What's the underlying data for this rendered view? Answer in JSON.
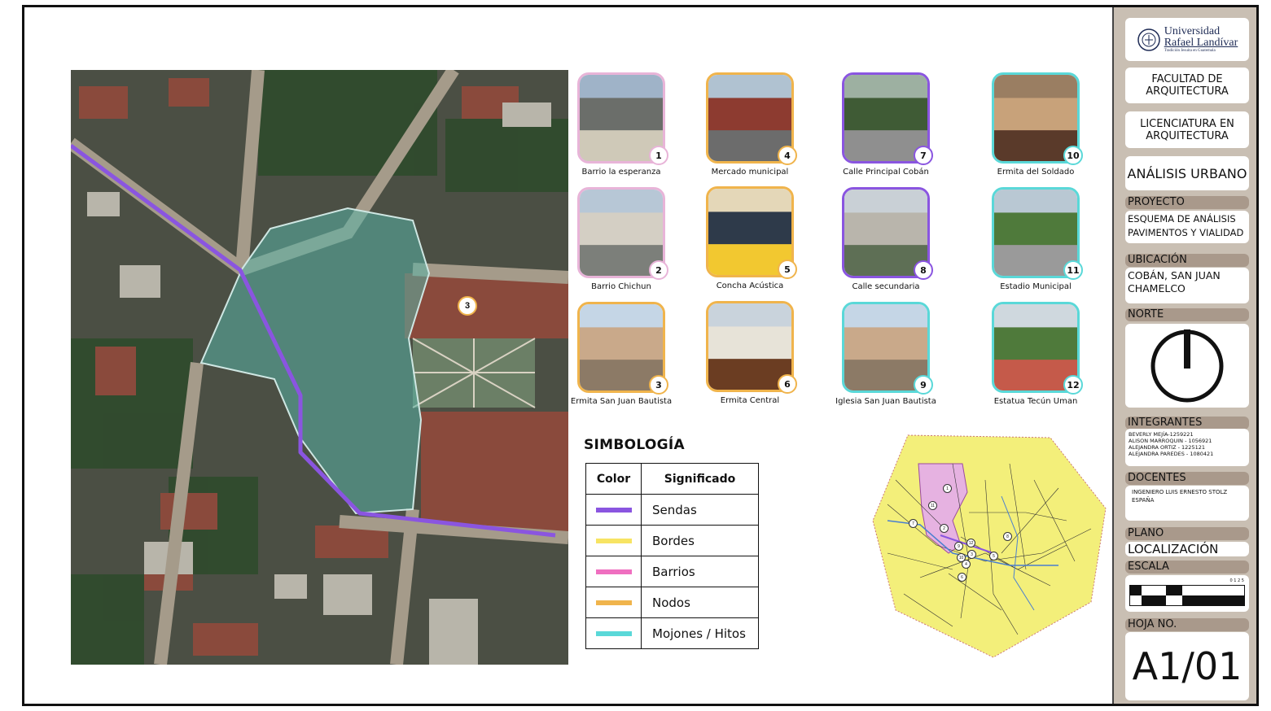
{
  "photos": [
    {
      "num": "1",
      "caption": "Barrio la esperanza",
      "color": "#e8b4d8"
    },
    {
      "num": "2",
      "caption": "Barrio Chichun",
      "color": "#e8b4d8"
    },
    {
      "num": "3",
      "caption": "Ermita San Juan Bautista",
      "color": "#f0b44c"
    },
    {
      "num": "4",
      "caption": "Mercado municipal",
      "color": "#f0b44c"
    },
    {
      "num": "5",
      "caption": "Concha Acústica",
      "color": "#f0b44c"
    },
    {
      "num": "6",
      "caption": "Ermita Central",
      "color": "#f0b44c"
    },
    {
      "num": "7",
      "caption": "Calle Principal Cobán",
      "color": "#8a55e0"
    },
    {
      "num": "8",
      "caption": "Calle secundaria",
      "color": "#8a55e0"
    },
    {
      "num": "9",
      "caption": "Iglesia San Juan Bautista",
      "color": "#5ad8d8"
    },
    {
      "num": "10",
      "caption": "Ermita del Soldado",
      "color": "#5ad8d8"
    },
    {
      "num": "11",
      "caption": "Estadio Municipal",
      "color": "#5ad8d8"
    },
    {
      "num": "12",
      "caption": "Estatua Tecún Uman",
      "color": "#5ad8d8"
    }
  ],
  "map_marker": "3",
  "legend": {
    "title": "SIMBOLOGÍA",
    "col_color": "Color",
    "col_meaning": "Significado",
    "rows": [
      {
        "label": "Sendas",
        "color": "#8a55e0"
      },
      {
        "label": "Bordes",
        "color": "#f7e463"
      },
      {
        "label": "Barrios",
        "color": "#ef6fc0"
      },
      {
        "label": "Nodos",
        "color": "#f0b44c"
      },
      {
        "label": "Mojones / Hitos",
        "color": "#5ad8d8"
      }
    ]
  },
  "locator_labels": [
    "1",
    "11",
    "7",
    "2",
    "9",
    "12",
    "3",
    "4",
    "5",
    "6",
    "8",
    "10"
  ],
  "title_block": {
    "uni_line1": "Universidad",
    "uni_line2": "Rafael Landívar",
    "uni_tagline": "Tradición Jesuita en Guatemala",
    "faculty": "FACULTAD DE ARQUITECTURA",
    "degree": "LICENCIATURA EN ARQUITECTURA",
    "course": "ANÁLISIS URBANO",
    "project_header": "PROYECTO",
    "project": "ESQUEMA DE ANÁLISIS PAVIMENTOS Y VIALIDAD",
    "location_header": "UBICACIÓN",
    "location": "COBÁN, SAN JUAN CHAMELCO",
    "north_header": "NORTE",
    "members_header": "INTEGRANTES",
    "members": [
      "BEVERLY MEJÍA-1259221",
      "ALISON MARROQUIN - 1056921",
      "ALEJANDRA ORTIZ - 1225121",
      "ALEJANDRA PAREDES - 1080421"
    ],
    "teachers_header": "DOCENTES",
    "teacher": "INGENIERO LUIS ERNESTO STOLZ ESPAÑA",
    "plan_header": "PLANO",
    "plan": "LOCALIZACIÓN",
    "scale_header": "ESCALA",
    "scale_ticks": "0  1  2  5",
    "sheet_header": "HOJA NO.",
    "sheet": "A1/01"
  }
}
